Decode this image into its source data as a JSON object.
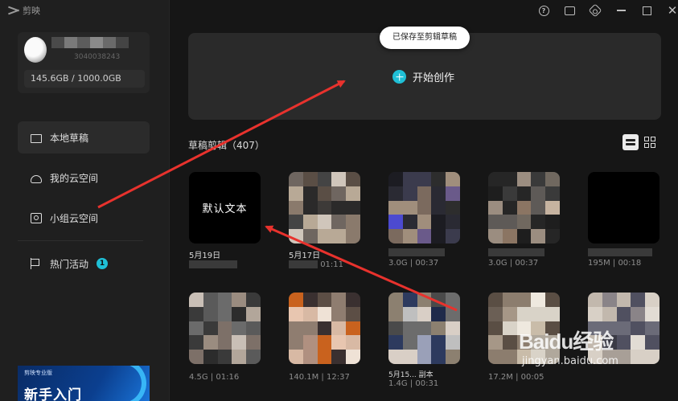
{
  "app": {
    "title": "剪映"
  },
  "window_controls": {
    "help": "?",
    "minimize": "",
    "maximize": "",
    "close": "✕"
  },
  "user": {
    "id_masked": "3040038243",
    "storage": "145.6GB / 1000.0GB"
  },
  "sidebar": {
    "items": [
      {
        "label": "本地草稿",
        "icon": "folder-icon",
        "active": true
      },
      {
        "label": "我的云空间",
        "icon": "cloud-icon",
        "active": false
      },
      {
        "label": "小组云空间",
        "icon": "group-space-icon",
        "active": false
      },
      {
        "label": "热门活动",
        "icon": "flag-icon",
        "active": false,
        "badge": "1"
      }
    ],
    "promo": {
      "top": "剪映专业版",
      "title": "新手入门"
    }
  },
  "main": {
    "toast": "已保存至剪辑草稿",
    "create_label": "开始创作",
    "section_title": "草稿剪辑（407）"
  },
  "drafts": [
    {
      "thumb_text": "默认文本",
      "date": "5月19日",
      "info": ""
    },
    {
      "thumb_text": "",
      "date": "5月17日",
      "info": "01:11"
    },
    {
      "thumb_text": "",
      "date": "",
      "info": "3.0G | 00:37"
    },
    {
      "thumb_text": "",
      "date": "",
      "info": "3.0G | 00:37"
    },
    {
      "thumb_text": "",
      "date": "",
      "info": "195M | 00:18"
    },
    {
      "thumb_text": "",
      "date": "",
      "info": "4.5G | 01:16"
    },
    {
      "thumb_text": "",
      "date": "",
      "info": "140.1M | 12:37"
    },
    {
      "thumb_text": "",
      "date": "5月15... 副本",
      "info": "1.4G | 00:31"
    },
    {
      "thumb_text": "",
      "date": "",
      "info": "17.2M | 00:05"
    },
    {
      "thumb_text": "",
      "date": "",
      "info": ""
    }
  ],
  "watermark": {
    "brand": "Baidu经验",
    "url": "jingyan.baidu.com"
  },
  "colors": {
    "accent": "#1fbfd6",
    "annotation_arrow": "#e8322d",
    "background": "#161616"
  }
}
